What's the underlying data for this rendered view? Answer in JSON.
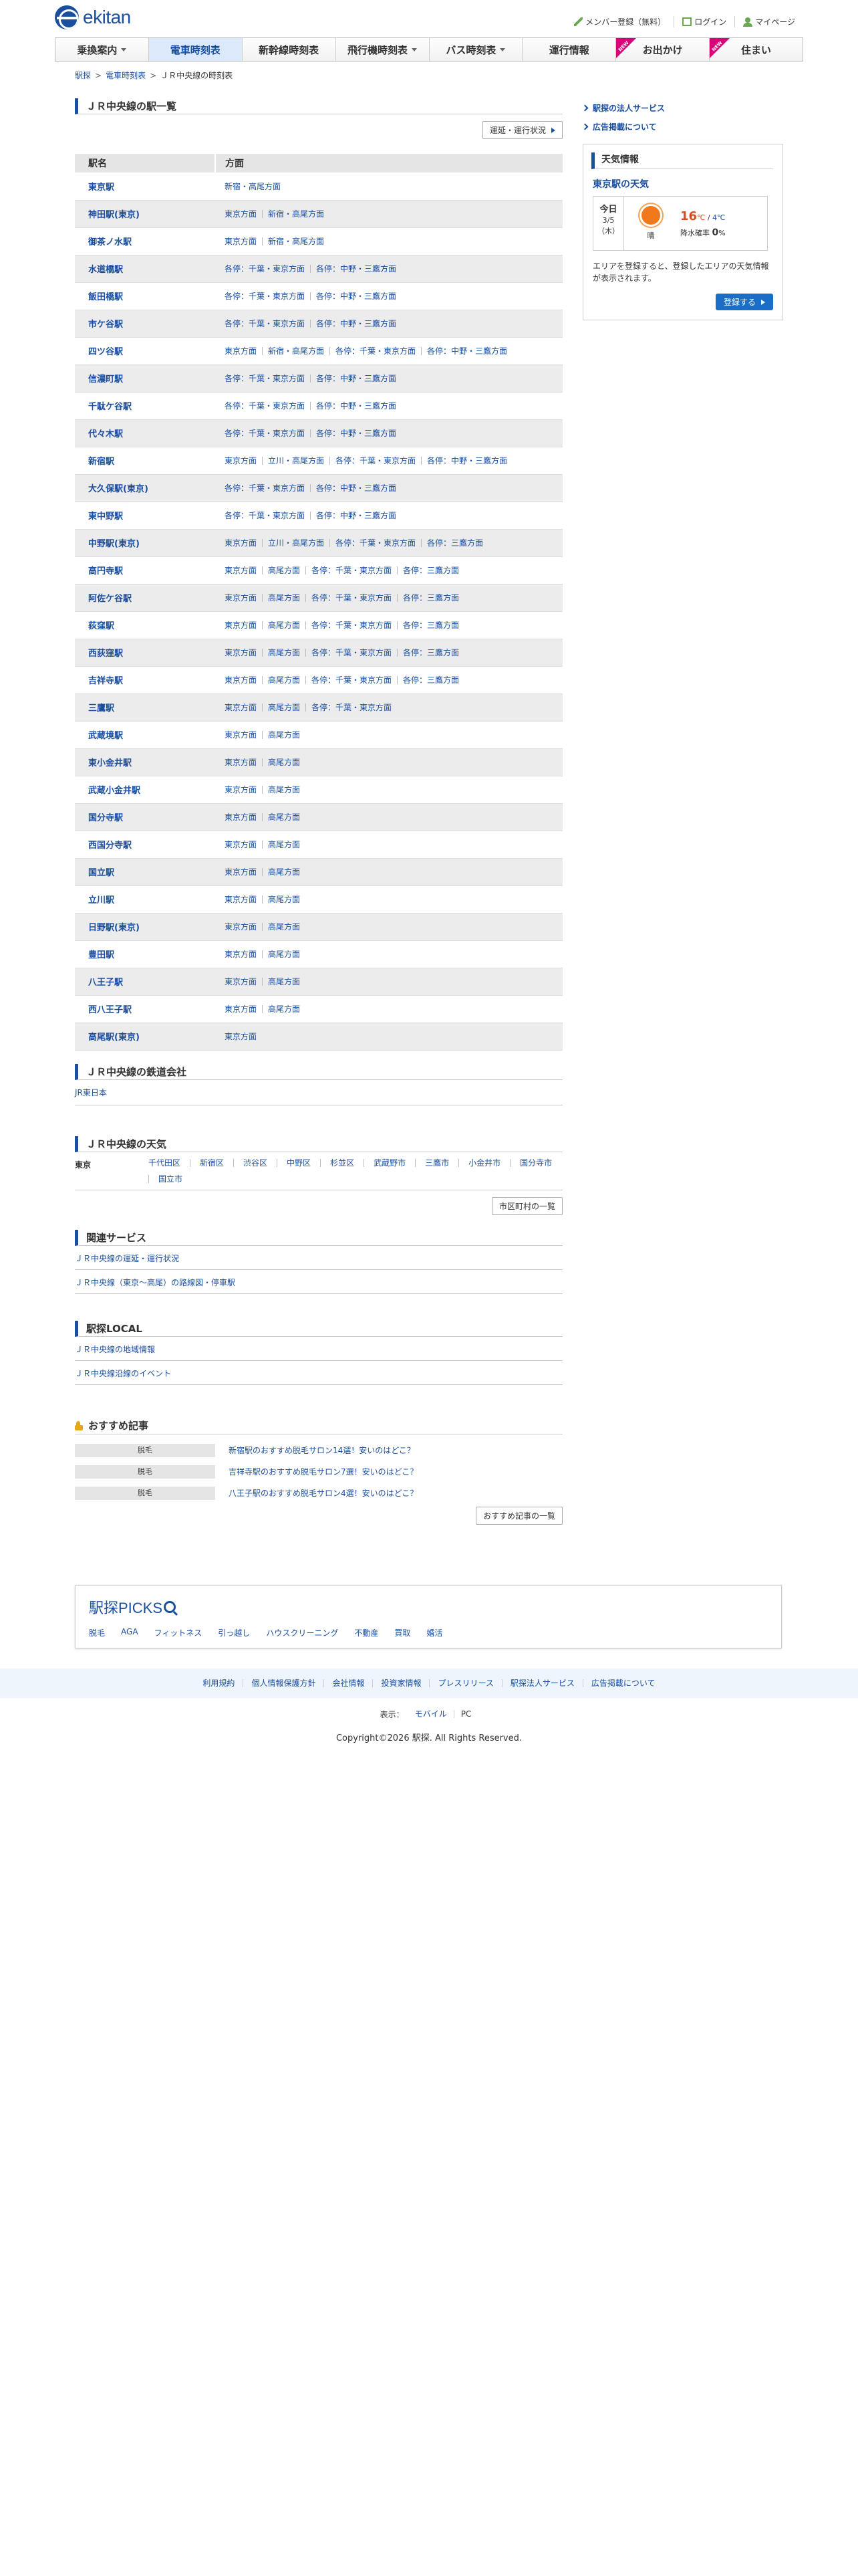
{
  "header": {
    "logo": "ekitan",
    "menu": [
      "メンバー登録（無料）",
      "ログイン",
      "マイページ"
    ]
  },
  "gnav": [
    {
      "label": "乗換案内",
      "dd": true
    },
    {
      "label": "電車時刻表",
      "dd": false,
      "active": true
    },
    {
      "label": "新幹線時刻表",
      "dd": false
    },
    {
      "label": "飛行機時刻表",
      "dd": true
    },
    {
      "label": "バス時刻表",
      "dd": true
    },
    {
      "label": "運行情報",
      "dd": false
    },
    {
      "label": "お出かけ",
      "dd": false,
      "new": true
    },
    {
      "label": "住まい",
      "dd": false,
      "new": true
    }
  ],
  "new_badge": "NEW",
  "breadcrumb": [
    "駅探",
    "電車時刻表",
    "ＪＲ中央線の時刻表"
  ],
  "main": {
    "title": "ＪＲ中央線の駅一覧",
    "status_button": "運延・運行状況",
    "table_head": [
      "駅名",
      "方面"
    ],
    "stations": [
      {
        "name": "東京駅",
        "dirs": [
          "新宿・高尾方面"
        ]
      },
      {
        "name": "神田駅(東京)",
        "dirs": [
          "東京方面",
          "新宿・高尾方面"
        ]
      },
      {
        "name": "御茶ノ水駅",
        "dirs": [
          "東京方面",
          "新宿・高尾方面"
        ]
      },
      {
        "name": "水道橋駅",
        "dirs": [
          "各停：千葉・東京方面",
          "各停：中野・三鷹方面"
        ]
      },
      {
        "name": "飯田橋駅",
        "dirs": [
          "各停：千葉・東京方面",
          "各停：中野・三鷹方面"
        ]
      },
      {
        "name": "市ケ谷駅",
        "dirs": [
          "各停：千葉・東京方面",
          "各停：中野・三鷹方面"
        ]
      },
      {
        "name": "四ツ谷駅",
        "dirs": [
          "東京方面",
          "新宿・高尾方面",
          "各停：千葉・東京方面",
          "各停：中野・三鷹方面"
        ]
      },
      {
        "name": "信濃町駅",
        "dirs": [
          "各停：千葉・東京方面",
          "各停：中野・三鷹方面"
        ]
      },
      {
        "name": "千駄ケ谷駅",
        "dirs": [
          "各停：千葉・東京方面",
          "各停：中野・三鷹方面"
        ]
      },
      {
        "name": "代々木駅",
        "dirs": [
          "各停：千葉・東京方面",
          "各停：中野・三鷹方面"
        ]
      },
      {
        "name": "新宿駅",
        "dirs": [
          "東京方面",
          "立川・高尾方面",
          "各停：千葉・東京方面",
          "各停：中野・三鷹方面"
        ]
      },
      {
        "name": "大久保駅(東京)",
        "dirs": [
          "各停：千葉・東京方面",
          "各停：中野・三鷹方面"
        ]
      },
      {
        "name": "東中野駅",
        "dirs": [
          "各停：千葉・東京方面",
          "各停：中野・三鷹方面"
        ]
      },
      {
        "name": "中野駅(東京)",
        "dirs": [
          "東京方面",
          "立川・高尾方面",
          "各停：千葉・東京方面",
          "各停：三鷹方面"
        ]
      },
      {
        "name": "高円寺駅",
        "dirs": [
          "東京方面",
          "高尾方面",
          "各停：千葉・東京方面",
          "各停：三鷹方面"
        ]
      },
      {
        "name": "阿佐ケ谷駅",
        "dirs": [
          "東京方面",
          "高尾方面",
          "各停：千葉・東京方面",
          "各停：三鷹方面"
        ]
      },
      {
        "name": "荻窪駅",
        "dirs": [
          "東京方面",
          "高尾方面",
          "各停：千葉・東京方面",
          "各停：三鷹方面"
        ]
      },
      {
        "name": "西荻窪駅",
        "dirs": [
          "東京方面",
          "高尾方面",
          "各停：千葉・東京方面",
          "各停：三鷹方面"
        ]
      },
      {
        "name": "吉祥寺駅",
        "dirs": [
          "東京方面",
          "高尾方面",
          "各停：千葉・東京方面",
          "各停：三鷹方面"
        ]
      },
      {
        "name": "三鷹駅",
        "dirs": [
          "東京方面",
          "高尾方面",
          "各停：千葉・東京方面"
        ]
      },
      {
        "name": "武蔵境駅",
        "dirs": [
          "東京方面",
          "高尾方面"
        ]
      },
      {
        "name": "東小金井駅",
        "dirs": [
          "東京方面",
          "高尾方面"
        ]
      },
      {
        "name": "武蔵小金井駅",
        "dirs": [
          "東京方面",
          "高尾方面"
        ]
      },
      {
        "name": "国分寺駅",
        "dirs": [
          "東京方面",
          "高尾方面"
        ]
      },
      {
        "name": "西国分寺駅",
        "dirs": [
          "東京方面",
          "高尾方面"
        ]
      },
      {
        "name": "国立駅",
        "dirs": [
          "東京方面",
          "高尾方面"
        ]
      },
      {
        "name": "立川駅",
        "dirs": [
          "東京方面",
          "高尾方面"
        ]
      },
      {
        "name": "日野駅(東京)",
        "dirs": [
          "東京方面",
          "高尾方面"
        ]
      },
      {
        "name": "豊田駅",
        "dirs": [
          "東京方面",
          "高尾方面"
        ]
      },
      {
        "name": "八王子駅",
        "dirs": [
          "東京方面",
          "高尾方面"
        ]
      },
      {
        "name": "西八王子駅",
        "dirs": [
          "東京方面",
          "高尾方面"
        ]
      },
      {
        "name": "高尾駅(東京)",
        "dirs": [
          "東京方面"
        ]
      }
    ],
    "company_title": "ＪＲ中央線の鉄道会社",
    "company": "JR東日本",
    "weather_title": "ＪＲ中央線の天気",
    "weather_pref": "東京",
    "weather_cities": [
      "千代田区",
      "新宿区",
      "渋谷区",
      "中野区",
      "杉並区",
      "武蔵野市",
      "三鷹市",
      "小金井市",
      "国分寺市",
      "国立市"
    ],
    "weather_more": "市区町村の一覧",
    "related_title": "関連サービス",
    "related": [
      "ＪＲ中央線の運延・運行状況",
      "ＪＲ中央線（東京～高尾）の路線図・停車駅"
    ],
    "local_title": "駅探LOCAL",
    "local": [
      "ＪＲ中央線の地域情報",
      "ＪＲ中央線沿線のイベント"
    ],
    "articles_title": "おすすめ記事",
    "articles": [
      {
        "tag": "脱毛",
        "title": "新宿駅のおすすめ脱毛サロン14選！安いのはどこ？"
      },
      {
        "tag": "脱毛",
        "title": "吉祥寺駅のおすすめ脱毛サロン7選！安いのはどこ？"
      },
      {
        "tag": "脱毛",
        "title": "八王子駅のおすすめ脱毛サロン4選！安いのはどこ？"
      }
    ],
    "articles_more": "おすすめ記事の一覧"
  },
  "side": {
    "links": [
      "駅探の法人サービス",
      "広告掲載について"
    ],
    "weather": {
      "title": "天気情報",
      "station": "東京駅の天気",
      "day": "今日",
      "date": "3/5",
      "dow": "（木）",
      "cond": "晴",
      "hi": "16",
      "hi_unit": "℃",
      "lo": "4℃",
      "rain_label": "降水確率",
      "rain": "0",
      "rain_unit": "%",
      "note": "エリアを登録すると、登録したエリアの天気情報が表示されます。",
      "register": "登録する"
    }
  },
  "picks": {
    "logo": "駅探PICKS",
    "cats": [
      "脱毛",
      "AGA",
      "フィットネス",
      "引っ越し",
      "ハウスクリーニング",
      "不動産",
      "買取",
      "婚活"
    ]
  },
  "footer": {
    "links": [
      "利用規約",
      "個人情報保護方針",
      "会社情報",
      "投資家情報",
      "プレスリリース",
      "駅探法人サービス",
      "広告掲載について"
    ],
    "display_label": "表示：",
    "display_opts": [
      "モバイル",
      "PC"
    ],
    "copyright": "Copyright©2026 駅探. All Rights Reserved."
  },
  "colors": {
    "accent": "#1a4e9e",
    "tag_new": "#d9007a",
    "green": "#6aa84f",
    "sun": "#f07a1b"
  }
}
